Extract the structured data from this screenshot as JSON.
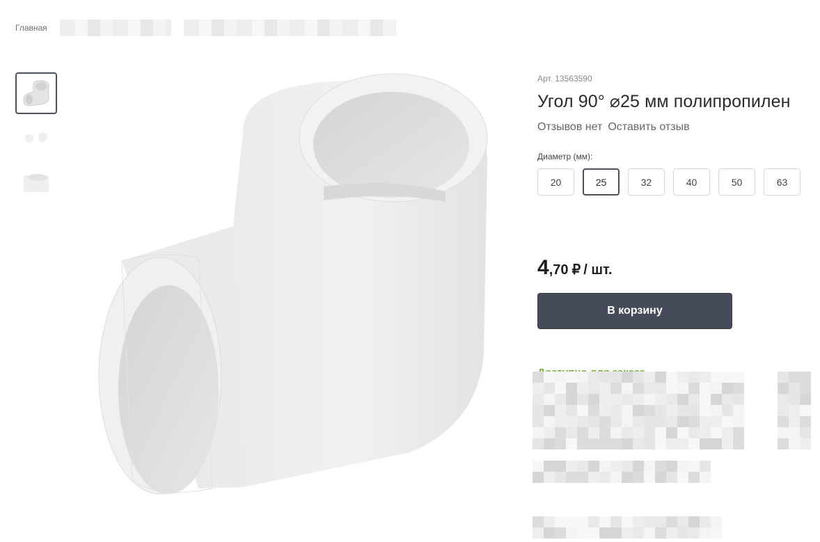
{
  "breadcrumb": {
    "home_label": "Главная"
  },
  "product": {
    "sku_label": "Арт. 13563590",
    "title": "Угол 90° ⌀25 мм полипропилен",
    "reviews_none": "Отзывов нет",
    "leave_review": "Оставить отзыв",
    "diameter_label": "Диаметр (мм):",
    "diameters": [
      "20",
      "25",
      "32",
      "40",
      "50",
      "63"
    ],
    "selected_diameter": "25",
    "price": {
      "integer": "4",
      "fraction": ",70",
      "currency": "₽",
      "unit": "/ шт."
    },
    "add_to_cart_label": "В корзину",
    "availability": "Доступно для заказа"
  },
  "gallery": {
    "thumbnails": [
      "elbow-front",
      "elbow-pair",
      "coupling-side"
    ],
    "active_thumbnail": 0
  },
  "colors": {
    "button_bg": "#464b59",
    "availability_green": "#7cb342",
    "active_border": "#4a4f5c"
  }
}
